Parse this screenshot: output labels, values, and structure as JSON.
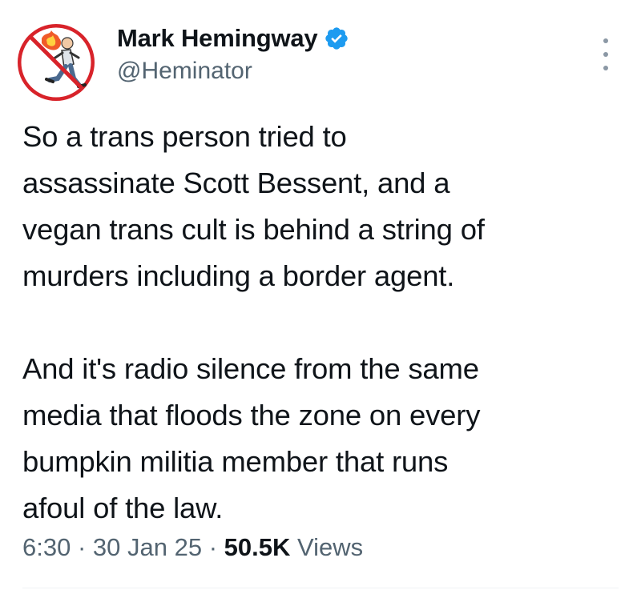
{
  "author": {
    "display_name": "Mark Hemingway",
    "handle": "@Heminator",
    "verified": true,
    "avatar_icon": "man-running-from-fire-icon"
  },
  "tweet": {
    "paragraphs": [
      "So a trans person tried to\nassassinate Scott Bessent, and a\nvegan trans cult is behind a string of\nmurders including a border agent.",
      "And it's radio silence from the same\nmedia that floods the zone on every\nbumpkin militia member that runs\nafoul of the law."
    ]
  },
  "meta": {
    "time": "6:30",
    "separator": "·",
    "date": "30 Jan 25",
    "views_count": "50.5K",
    "views_label": "Views"
  },
  "icons": {
    "more": "more-options-icon",
    "verified": "verified-badge-icon"
  },
  "colors": {
    "verified_blue": "#1d9bf0",
    "secondary_text": "#536471",
    "primary_text": "#0f1419"
  }
}
